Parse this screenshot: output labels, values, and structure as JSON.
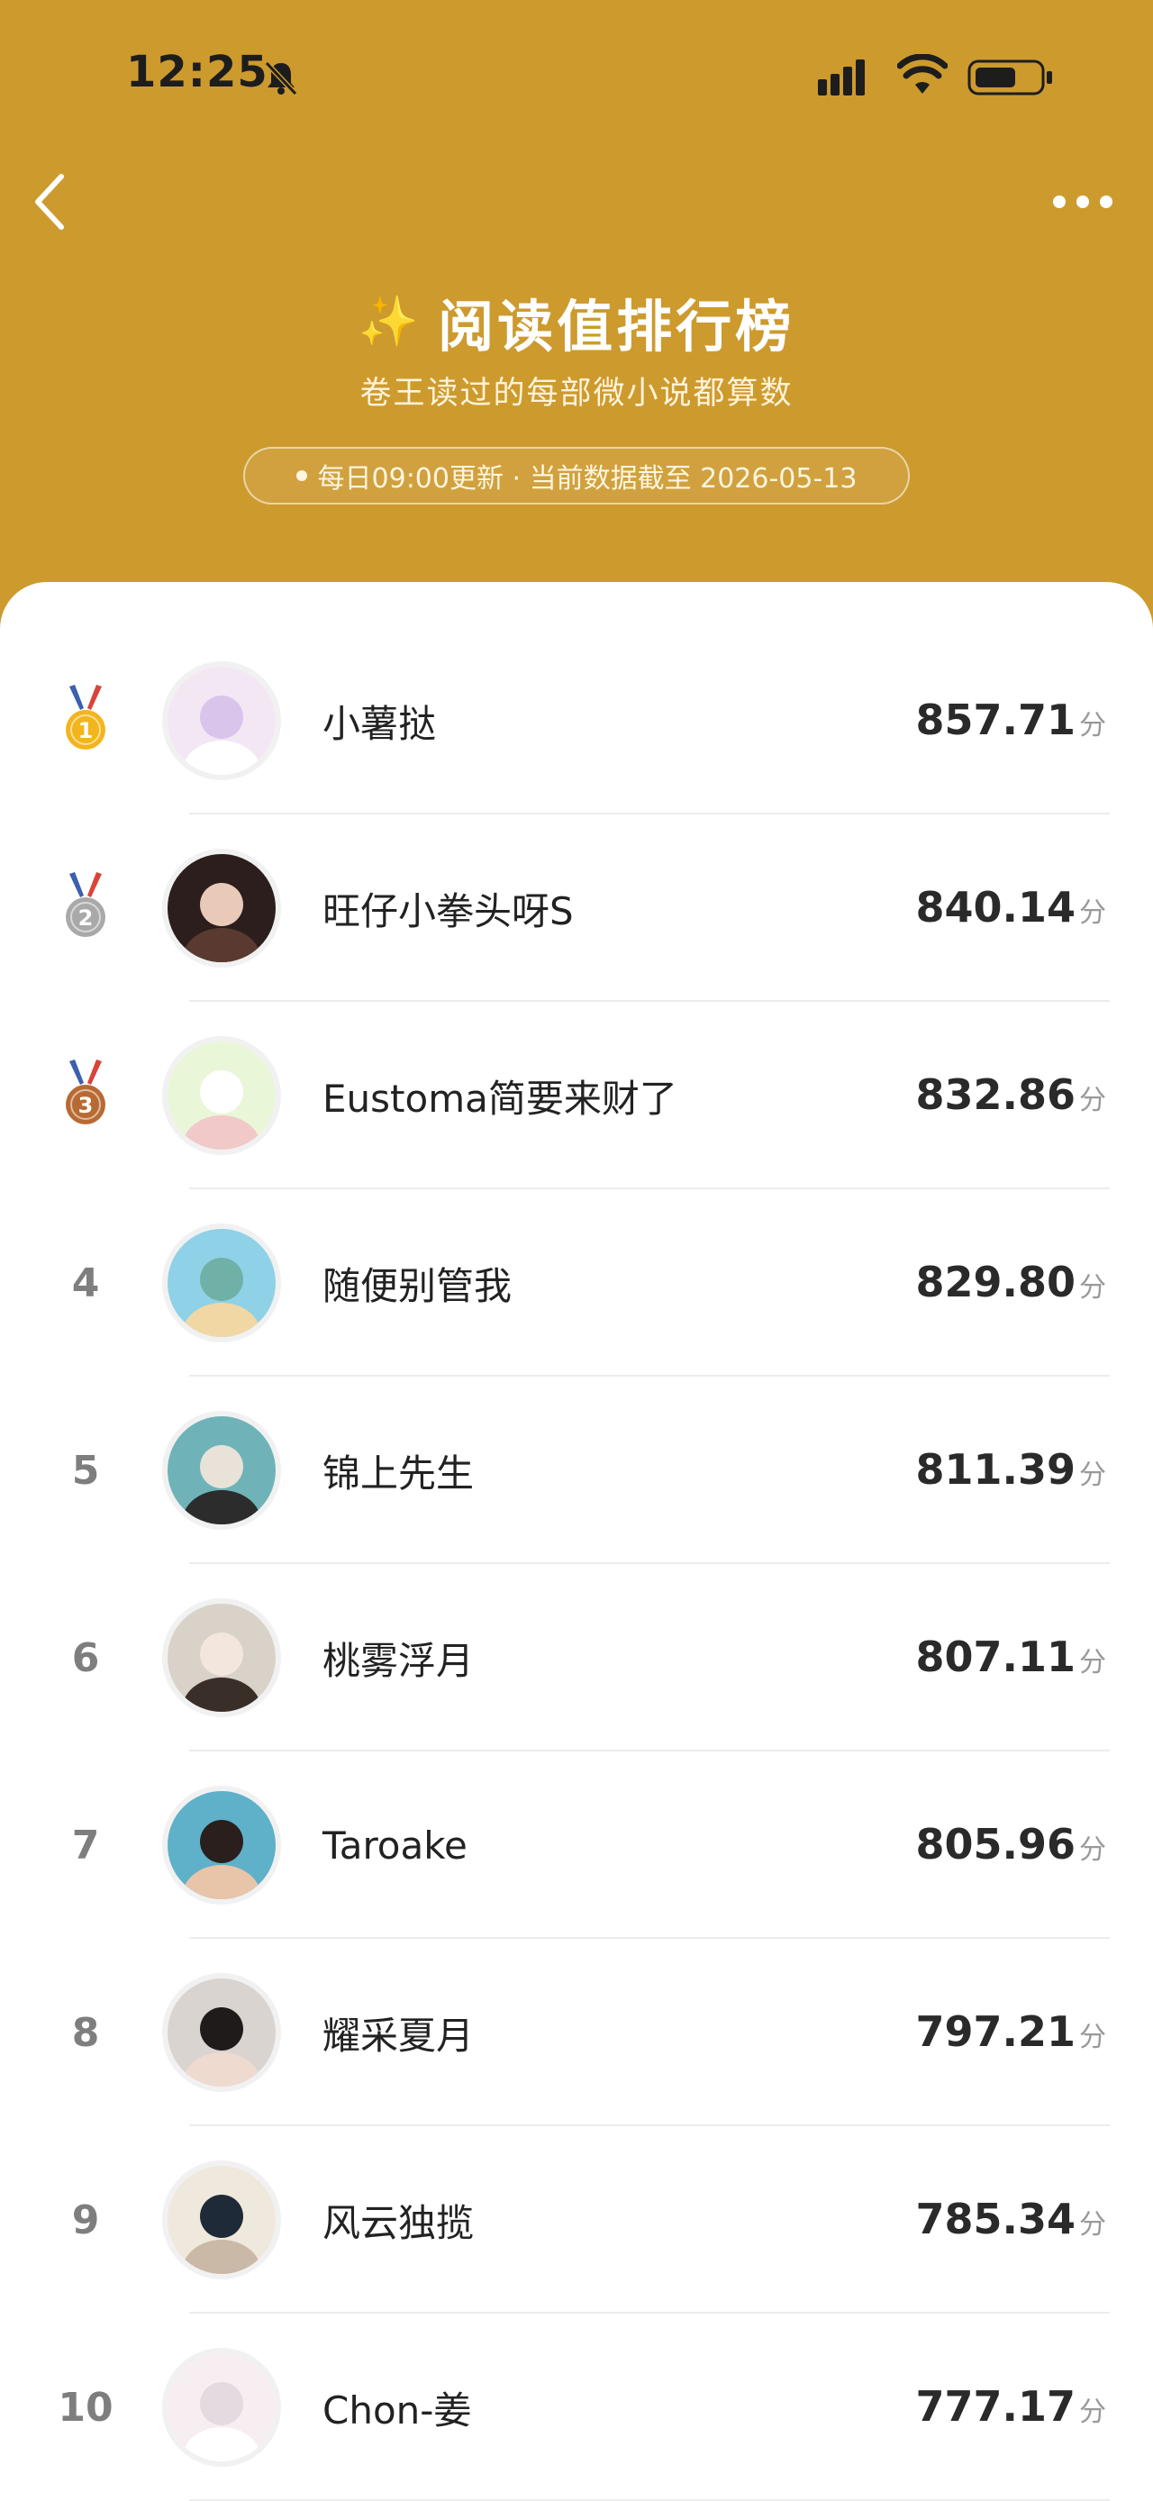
{
  "status_bar": {
    "time": "12:25"
  },
  "header": {
    "sparkle": "✨",
    "title": "阅读值排行榜",
    "subtitle": "卷王读过的每部微小说都算数",
    "update_note": "每日09:00更新 · 当前数据截至 2026-05-13"
  },
  "colors": {
    "header_bg": "#cd9a2e",
    "medal_gold": "#f2b51e",
    "medal_silver": "#a9a9a9",
    "medal_bronze": "#b86a33"
  },
  "score_unit": "分",
  "rankings": [
    {
      "rank": "1",
      "name": "小薯挞",
      "score": "857.71",
      "medal": "gold-medal-icon"
    },
    {
      "rank": "2",
      "name": "旺仔小拳头呀S",
      "score": "840.14",
      "medal": "silver-medal-icon"
    },
    {
      "rank": "3",
      "name": "Eustoma简要来财了",
      "score": "832.86",
      "medal": "bronze-medal-icon"
    },
    {
      "rank": "4",
      "name": "随便别管我",
      "score": "829.80"
    },
    {
      "rank": "5",
      "name": "锦上先生",
      "score": "811.39"
    },
    {
      "rank": "6",
      "name": "桃雾浮月",
      "score": "807.11"
    },
    {
      "rank": "7",
      "name": "Taroake",
      "score": "805.96"
    },
    {
      "rank": "8",
      "name": "耀采夏月",
      "score": "797.21"
    },
    {
      "rank": "9",
      "name": "风云独揽",
      "score": "785.34"
    },
    {
      "rank": "10",
      "name": "Chon-姜",
      "score": "777.17"
    }
  ]
}
